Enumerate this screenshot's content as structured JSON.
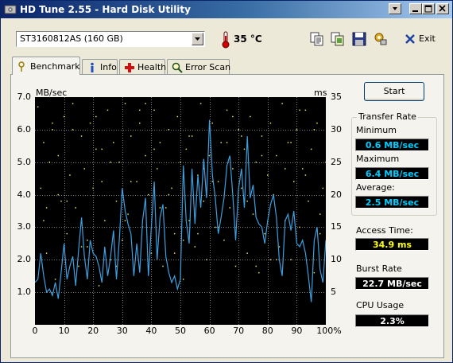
{
  "window": {
    "title": "HD Tune 2.55 - Hard Disk Utility"
  },
  "drive": {
    "selected": "ST3160812AS (160 GB)"
  },
  "temperature": {
    "value": "35 °C"
  },
  "toolbar": {
    "exit_label": "Exit"
  },
  "tabs": [
    {
      "label": "Benchmark",
      "icon": "benchmark-icon",
      "active": true
    },
    {
      "label": "Info",
      "icon": "info-icon",
      "active": false
    },
    {
      "label": "Health",
      "icon": "health-icon",
      "active": false
    },
    {
      "label": "Error Scan",
      "icon": "error-scan-icon",
      "active": false
    }
  ],
  "buttons": {
    "start": "Start"
  },
  "results": {
    "transfer_rate_title": "Transfer Rate",
    "minimum_label": "Minimum",
    "minimum_value": "0.6 MB/sec",
    "maximum_label": "Maximum",
    "maximum_value": "6.4 MB/sec",
    "average_label": "Average:",
    "average_value": "2.5 MB/sec",
    "access_time_label": "Access Time:",
    "access_time_value": "34.9 ms",
    "burst_rate_label": "Burst Rate",
    "burst_rate_value": "22.7 MB/sec",
    "cpu_usage_label": "CPU Usage",
    "cpu_usage_value": "2.3%"
  },
  "colors": {
    "value_cyan": "#00CCFF",
    "value_yellow": "#FFFF00",
    "value_white": "#FFFFFF",
    "transfer_line": "#3CA0E0",
    "access_dots": "#E8E060",
    "grid": "#7F7F7F"
  },
  "chart_data": {
    "type": "line",
    "title": "",
    "xlabel": "",
    "y_left_label": "MB/sec",
    "y_right_label": "ms",
    "x_ticks": [
      "0",
      "10",
      "20",
      "30",
      "40",
      "50",
      "60",
      "70",
      "80",
      "90",
      "100%"
    ],
    "y_left_ticks": [
      "1.0",
      "2.0",
      "3.0",
      "4.0",
      "5.0",
      "6.0",
      "7.0"
    ],
    "y_right_ticks": [
      "5",
      "10",
      "15",
      "20",
      "25",
      "30",
      "35"
    ],
    "xlim": [
      0,
      100
    ],
    "ylim_left": [
      0,
      7
    ],
    "ylim_right": [
      0,
      35
    ],
    "grid": true,
    "series": [
      {
        "axis": "left",
        "x": [
          0,
          1,
          2,
          3,
          4,
          5,
          6,
          7,
          8,
          9,
          10,
          11,
          12,
          13,
          14,
          15,
          16,
          17,
          18,
          19,
          20,
          21,
          22,
          23,
          24,
          25,
          26,
          27,
          28,
          29,
          30,
          31,
          32,
          33,
          34,
          35,
          36,
          37,
          38,
          39,
          40,
          41,
          42,
          43,
          44,
          45,
          46,
          47,
          48,
          49,
          50,
          51,
          52,
          53,
          54,
          55,
          56,
          57,
          58,
          59,
          60,
          61,
          62,
          63,
          64,
          65,
          66,
          67,
          68,
          69,
          70,
          71,
          72,
          73,
          74,
          75,
          76,
          77,
          78,
          79,
          80,
          81,
          82,
          83,
          84,
          85,
          86,
          87,
          88,
          89,
          90,
          91,
          92,
          93,
          94,
          95,
          96,
          97,
          98,
          99,
          100
        ],
        "y": [
          1.3,
          1.4,
          2.2,
          1.5,
          1.0,
          1.1,
          0.9,
          1.3,
          0.8,
          1.6,
          2.5,
          1.4,
          1.8,
          2.1,
          1.2,
          2.3,
          3.3,
          2.1,
          1.4,
          2.6,
          2.2,
          2.1,
          1.8,
          1.3,
          2.4,
          1.5,
          2.1,
          2.9,
          1.4,
          2.6,
          4.2,
          3.5,
          3.1,
          2.8,
          1.5,
          2.5,
          1.6,
          3.2,
          3.9,
          1.5,
          3.0,
          4.4,
          2.0,
          3.3,
          3.7,
          2.1,
          1.6,
          1.3,
          1.5,
          1.1,
          1.4,
          4.9,
          3.2,
          2.5,
          4.8,
          3.1,
          4.6,
          3.6,
          5.1,
          3.9,
          6.3,
          4.6,
          3.9,
          2.8,
          3.3,
          3.9,
          4.9,
          5.2,
          4.0,
          2.6,
          4.2,
          4.8,
          3.6,
          5.8,
          3.9,
          4.3,
          3.3,
          3.1,
          3.0,
          2.5,
          3.2,
          3.7,
          4.0,
          3.3,
          2.0,
          1.5,
          3.2,
          3.4,
          2.9,
          3.5,
          2.5,
          2.4,
          2.6,
          2.2,
          1.5,
          0.7,
          2.6,
          3.0,
          1.7,
          1.3,
          2.6
        ]
      },
      {
        "axis": "right",
        "name": "",
        "x": [
          1,
          2,
          3,
          4,
          5,
          6,
          7,
          8,
          9,
          10,
          11,
          12,
          13,
          14,
          15,
          16,
          17,
          18,
          19,
          20,
          21,
          22,
          23,
          24,
          25,
          26,
          27,
          28,
          29,
          30,
          31,
          32,
          33,
          34,
          35,
          36,
          37,
          38,
          39,
          40,
          41,
          42,
          43,
          44,
          45,
          46,
          47,
          48,
          49,
          50,
          51,
          52,
          53,
          54,
          55,
          56,
          57,
          58,
          59,
          60,
          61,
          62,
          63,
          64,
          65,
          66,
          67,
          68,
          69,
          70,
          71,
          72,
          73,
          74,
          75,
          76,
          77,
          78,
          79,
          80,
          81,
          82,
          83,
          84,
          85,
          86,
          87,
          88,
          89,
          90,
          91,
          92,
          93,
          94,
          95,
          96,
          97,
          98,
          99,
          100,
          3,
          8,
          13,
          18,
          23,
          28,
          33,
          38,
          43,
          48,
          53,
          58,
          63,
          68,
          73,
          78,
          83,
          88,
          93,
          98,
          6,
          16,
          26,
          36,
          46,
          56,
          66,
          76,
          86,
          96,
          11,
          21,
          31,
          41,
          51,
          61,
          71,
          81,
          91,
          4
        ],
        "y": [
          33.5,
          21,
          28,
          11,
          25,
          30,
          7,
          26,
          19,
          32,
          14,
          23,
          34,
          18,
          9,
          29,
          24,
          12,
          31,
          21,
          27,
          6,
          22,
          16,
          33,
          10,
          28,
          19,
          25,
          13,
          34,
          17,
          29,
          8,
          22,
          31,
          15,
          26,
          20,
          11,
          33,
          24,
          28,
          9,
          18,
          30,
          21,
          14,
          32,
          25,
          7,
          27,
          16,
          29,
          12,
          23,
          34,
          19,
          10,
          26,
          31,
          15,
          22,
          28,
          13,
          33,
          18,
          24,
          9,
          30,
          21,
          27,
          11,
          32,
          17,
          25,
          8,
          29,
          14,
          23,
          31,
          20,
          26,
          12,
          34,
          16,
          28,
          10,
          22,
          30,
          15,
          24,
          33,
          19,
          27,
          8,
          31,
          14,
          21,
          25,
          16,
          20,
          30,
          13,
          27,
          9,
          22,
          34,
          18,
          11,
          29,
          24,
          15,
          32,
          19,
          26,
          10,
          28,
          23,
          17,
          31,
          12,
          25,
          33,
          20,
          14,
          28,
          9,
          24,
          30,
          19,
          32,
          16,
          27,
          13,
          22,
          29,
          10,
          33,
          18
        ]
      }
    ]
  }
}
